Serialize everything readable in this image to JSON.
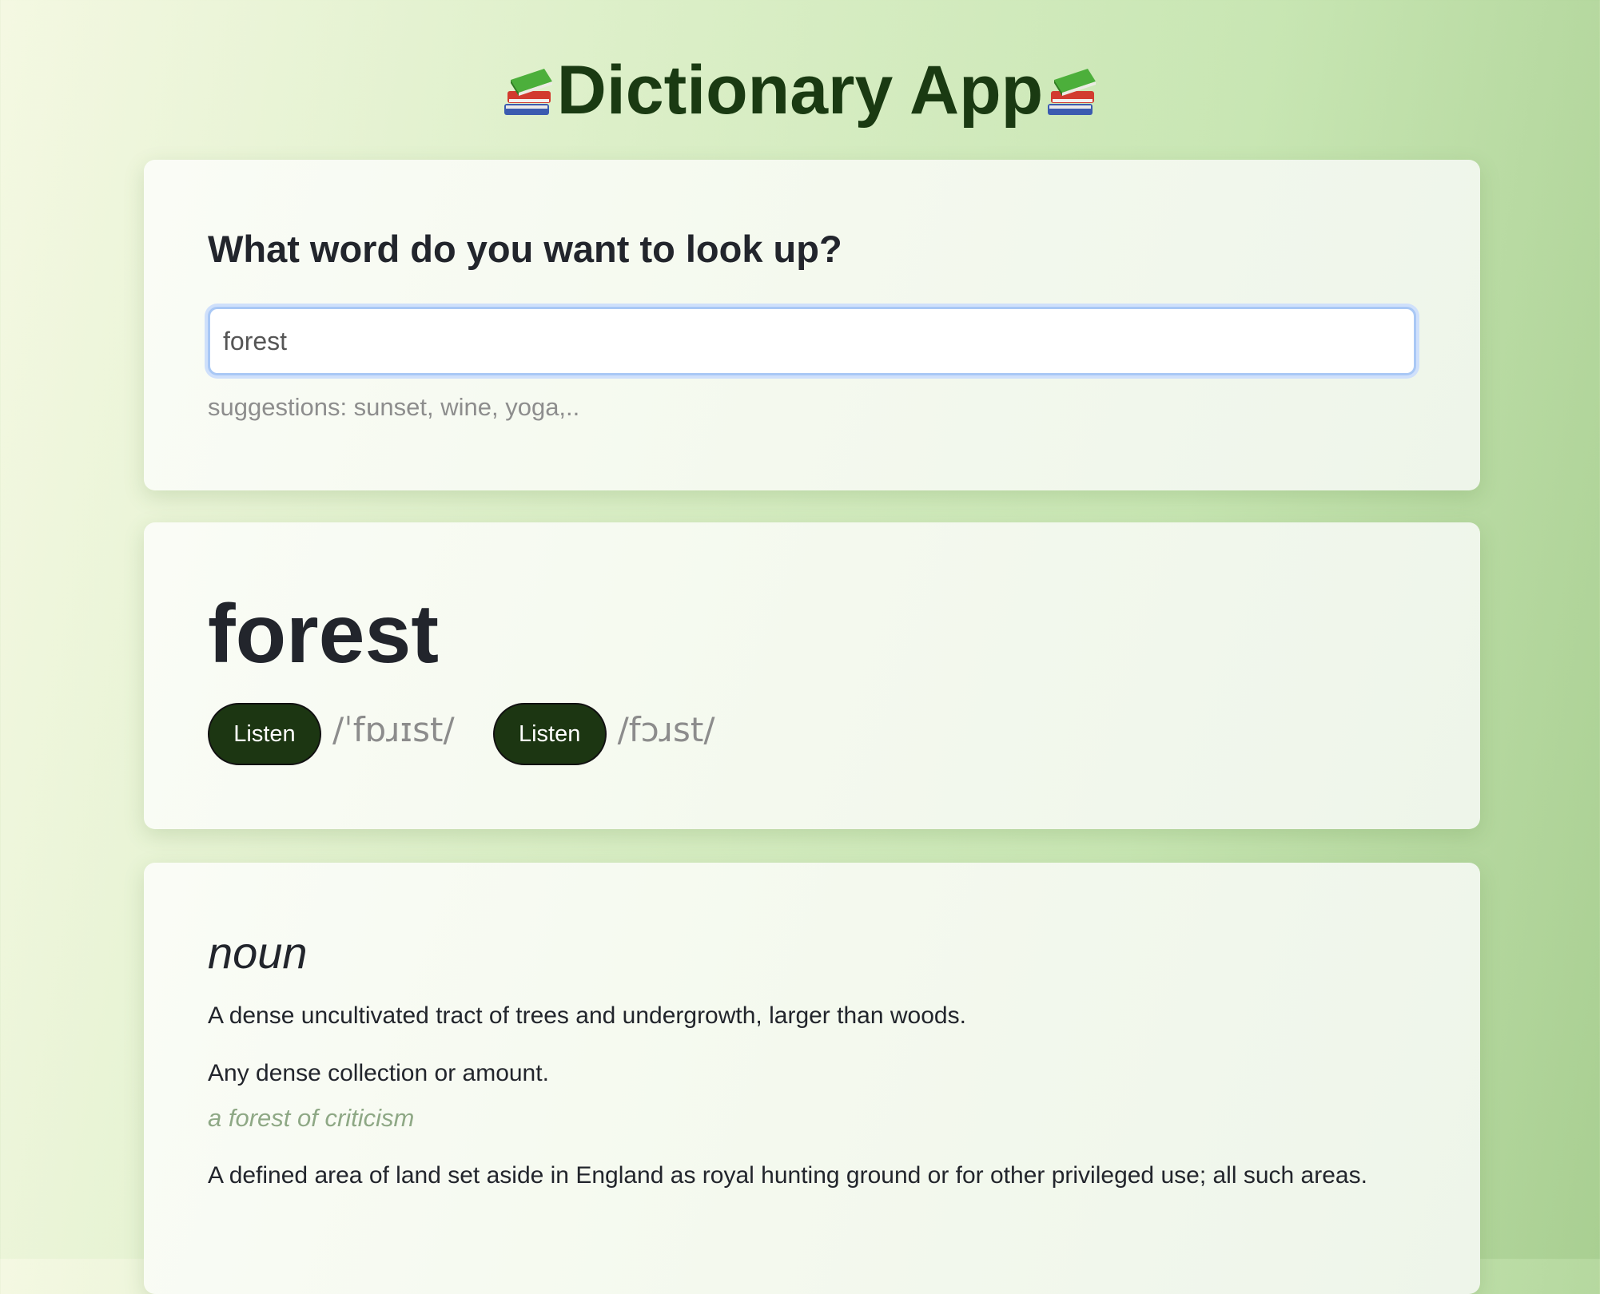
{
  "header": {
    "title": "Dictionary App",
    "icon": "books-icon"
  },
  "search": {
    "prompt": "What word do you want to look up?",
    "value": "forest",
    "suggestions": "suggestions: sunset, wine, yoga,.."
  },
  "word": {
    "headword": "forest",
    "phonetics": [
      {
        "button_label": "Listen",
        "ipa": "/ˈfɒɹɪst/"
      },
      {
        "button_label": "Listen",
        "ipa": "/fɔɹst/"
      }
    ]
  },
  "meaning": {
    "part_of_speech": "noun",
    "definitions": [
      {
        "text": "A dense uncultivated tract of trees and undergrowth, larger than woods.",
        "example": ""
      },
      {
        "text": "Any dense collection or amount.",
        "example": "a forest of criticism"
      },
      {
        "text": "A defined area of land set aside in England as royal hunting ground or for other privileged use; all such areas.",
        "example": ""
      }
    ]
  },
  "colors": {
    "title": "#1a3a12",
    "button": "#1c3612",
    "example": "#8ea885",
    "focus_ring": "#a9c8f5"
  }
}
